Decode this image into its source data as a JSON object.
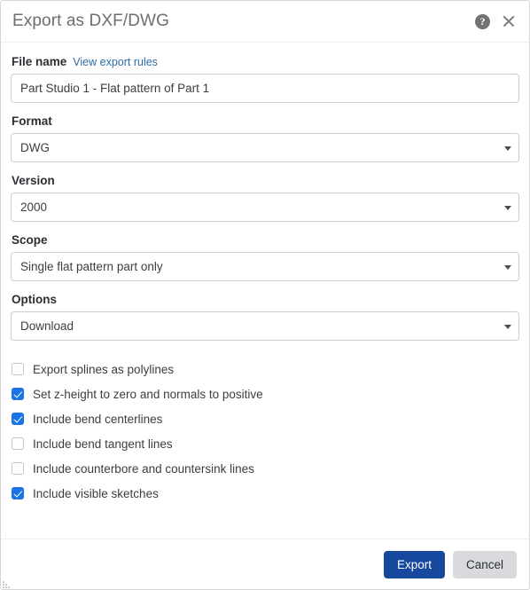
{
  "dialog": {
    "title": "Export as DXF/DWG",
    "help_icon": "help-circle-icon",
    "close_icon": "close-icon"
  },
  "fields": {
    "file_name": {
      "label": "File name",
      "link": "View export rules",
      "value": "Part Studio 1 - Flat pattern of Part 1",
      "placeholder": "File name"
    },
    "format": {
      "label": "Format",
      "value": "DWG"
    },
    "version": {
      "label": "Version",
      "value": "2000"
    },
    "scope": {
      "label": "Scope",
      "value": "Single flat pattern part only"
    },
    "options": {
      "label": "Options",
      "value": "Download"
    }
  },
  "checkboxes": [
    {
      "label": "Export splines as polylines",
      "checked": false
    },
    {
      "label": "Set z-height to zero and normals to positive",
      "checked": true
    },
    {
      "label": "Include bend centerlines",
      "checked": true
    },
    {
      "label": "Include bend tangent lines",
      "checked": false
    },
    {
      "label": "Include counterbore and countersink lines",
      "checked": false
    },
    {
      "label": "Include visible sketches",
      "checked": true
    }
  ],
  "footer": {
    "export_label": "Export",
    "cancel_label": "Cancel"
  },
  "colors": {
    "primary_button": "#16489e",
    "checkbox_checked": "#1a73e8",
    "link": "#2f6ca5",
    "title_text": "#6b6e72"
  }
}
